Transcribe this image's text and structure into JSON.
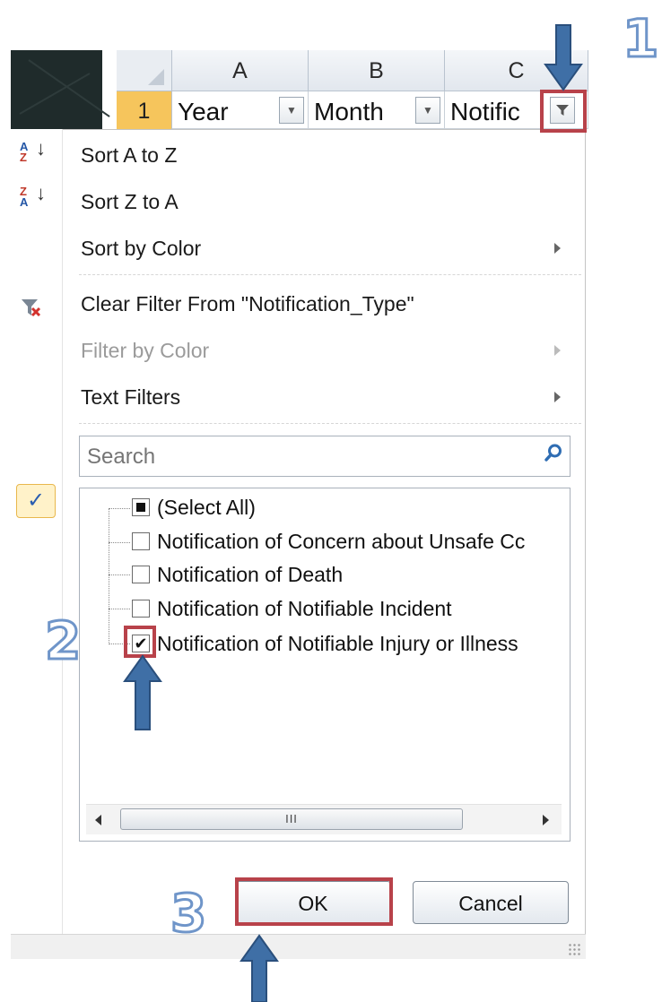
{
  "columns": [
    {
      "letter": "A"
    },
    {
      "letter": "B"
    },
    {
      "letter": "C"
    }
  ],
  "row": {
    "number": "1",
    "cells": [
      "Year",
      "Month",
      "Notific"
    ]
  },
  "menu": {
    "sort_az": "Sort A to Z",
    "sort_za": "Sort Z to A",
    "sort_by_color": "Sort by Color",
    "clear_filter": "Clear Filter From \"Notification_Type\"",
    "filter_by_color": "Filter by Color",
    "text_filters": "Text Filters"
  },
  "search": {
    "placeholder": "Search"
  },
  "filter_list": {
    "items": [
      {
        "label": "(Select All)",
        "state": "partial"
      },
      {
        "label": "Notification of Concern about Unsafe Cc",
        "state": "unchecked"
      },
      {
        "label": "Notification of Death",
        "state": "unchecked"
      },
      {
        "label": "Notification of Notifiable Incident",
        "state": "unchecked"
      },
      {
        "label": "Notification of Notifiable Injury or Illness",
        "state": "checked"
      }
    ],
    "scroll_thumb": "III"
  },
  "buttons": {
    "ok": "OK",
    "cancel": "Cancel"
  },
  "annotations": {
    "step1": "1",
    "step2": "2",
    "step3": "3"
  },
  "colors": {
    "annotation_red": "#b8424a",
    "annotation_blue": "#3f6fa6",
    "row_header": "#f6c55c"
  }
}
